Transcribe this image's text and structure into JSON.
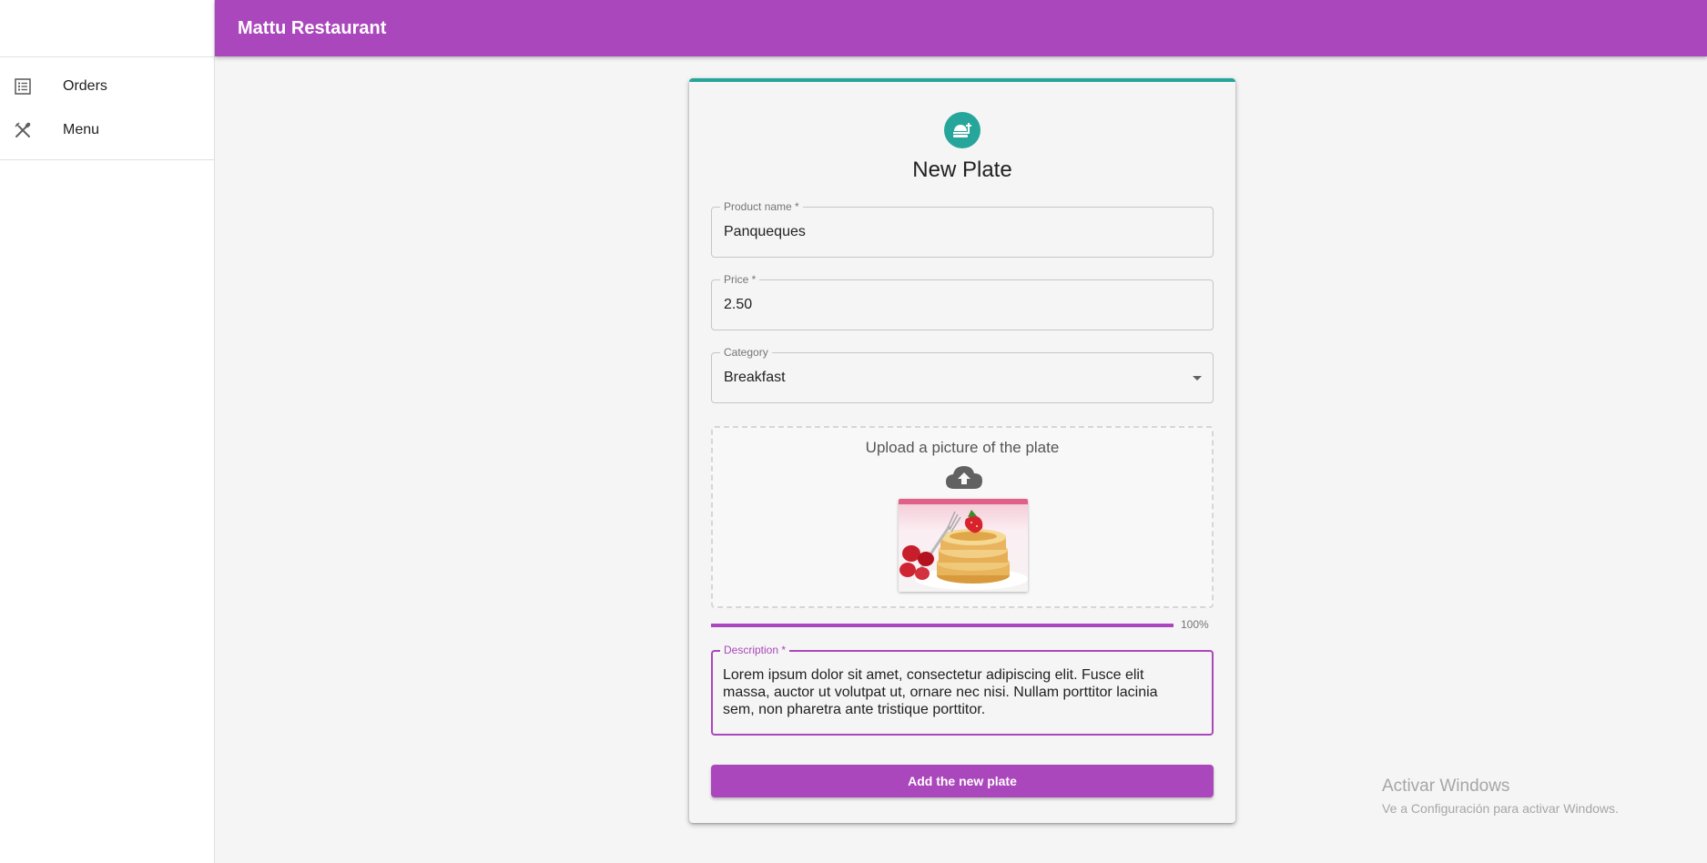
{
  "app": {
    "title": "Mattu Restaurant"
  },
  "sidebar": {
    "items": [
      {
        "label": "Orders",
        "icon": "list-icon"
      },
      {
        "label": "Menu",
        "icon": "utensils-icon"
      }
    ]
  },
  "form": {
    "title": "New Plate",
    "icon": "plate-icon",
    "product_name": {
      "label": "Product name *",
      "value": "Panqueques"
    },
    "price": {
      "label": "Price *",
      "value": "2.50"
    },
    "category": {
      "label": "Category",
      "value": "Breakfast"
    },
    "upload": {
      "label": "Upload a picture of the plate",
      "icon": "cloud-upload-icon",
      "image": "pancakes-thumbnail"
    },
    "progress": {
      "value": 1.0,
      "label": "100%"
    },
    "description": {
      "label": "Description *",
      "value": "Lorem ipsum dolor sit amet, consectetur adipiscing elit. Fusce elit massa, auctor ut volutpat ut, ornare nec nisi. Nullam porttitor lacinia sem, non pharetra ante tristique porttitor."
    },
    "submit_label": "Add the new plate"
  },
  "watermark": {
    "line1": "Activar Windows",
    "line2": "Ve a Configuración para activar Windows."
  },
  "colors": {
    "primary": "#ab47bc",
    "accent": "#26a69a",
    "background": "#f5f5f5"
  }
}
